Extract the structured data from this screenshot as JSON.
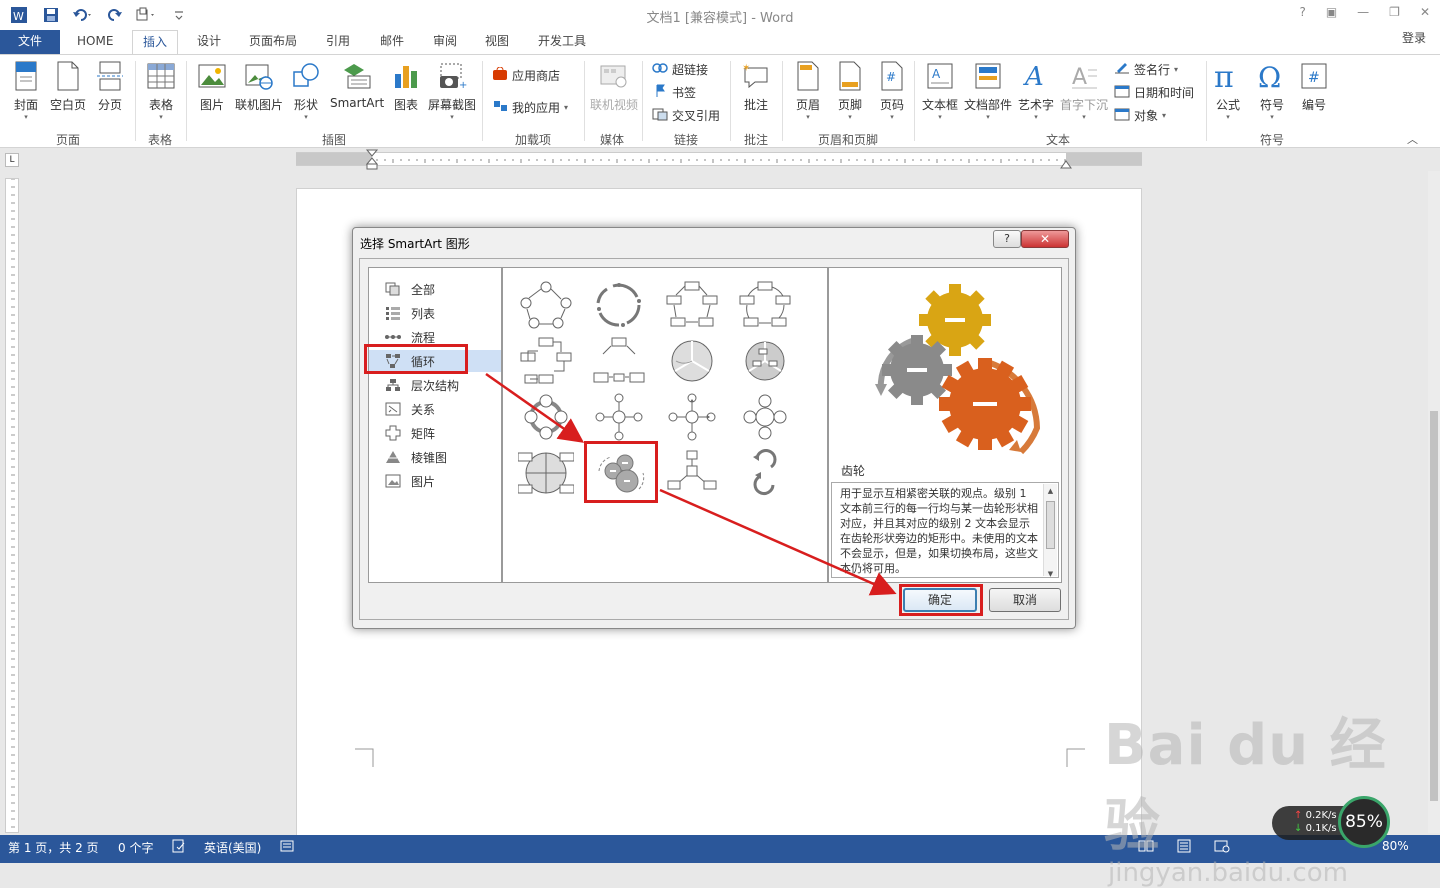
{
  "title_bar": {
    "title": "文档1 [兼容模式] - Word",
    "help": "?",
    "minimize": "—",
    "restore": "❐",
    "close": "✕"
  },
  "tabs": [
    {
      "label": "文件",
      "name": "tab-file"
    },
    {
      "label": "HOME",
      "name": "tab-home"
    },
    {
      "label": "插入",
      "name": "tab-insert"
    },
    {
      "label": "设计",
      "name": "tab-design"
    },
    {
      "label": "页面布局",
      "name": "tab-layout"
    },
    {
      "label": "引用",
      "name": "tab-references"
    },
    {
      "label": "邮件",
      "name": "tab-mailings"
    },
    {
      "label": "审阅",
      "name": "tab-review"
    },
    {
      "label": "视图",
      "name": "tab-view"
    },
    {
      "label": "开发工具",
      "name": "tab-developer"
    }
  ],
  "login": "登录",
  "ribbon": {
    "cover": "封面",
    "blank_page": "空白页",
    "page_break": "分页",
    "table": "表格",
    "picture": "图片",
    "online_picture": "联机图片",
    "shapes": "形状",
    "smartart": "SmartArt",
    "chart": "图表",
    "screenshot": "屏幕截图",
    "app_store": "应用商店",
    "my_apps": "我的应用",
    "online_video": "联机视频",
    "hyperlink": "超链接",
    "bookmark": "书签",
    "cross_ref": "交叉引用",
    "comment": "批注",
    "header": "页眉",
    "footer": "页脚",
    "page_number": "页码",
    "textbox": "文本框",
    "quick_parts": "文档部件",
    "wordart": "艺术字",
    "dropcap": "首字下沉",
    "signature": "签名行",
    "datetime": "日期和时间",
    "object": "对象",
    "equation": "公式",
    "symbol": "符号",
    "number": "编号",
    "groups": {
      "pages": "页面",
      "tables": "表格",
      "illustrations": "插图",
      "addins": "加载项",
      "media": "媒体",
      "links": "链接",
      "comments": "批注",
      "header_footer": "页眉和页脚",
      "text": "文本",
      "symbols": "符号"
    }
  },
  "dialog": {
    "title": "选择 SmartArt 图形",
    "help": "?",
    "close": "✕",
    "categories": [
      "全部",
      "列表",
      "流程",
      "循环",
      "层次结构",
      "关系",
      "矩阵",
      "棱锥图",
      "图片"
    ],
    "selected_category": "循环",
    "preview_name": "齿轮",
    "preview_desc": "用于显示互相紧密关联的观点。级别 1 文本前三行的每一行均与某一齿轮形状相对应，并且其对应的级别 2 文本会显示在齿轮形状旁边的矩形中。未使用的文本不会显示，但是，如果切换布局，这些文本仍将可用。",
    "ok": "确定",
    "cancel": "取消"
  },
  "status": {
    "page": "第 1 页，共 2 页",
    "words": "0 个字",
    "language": "英语(美国)",
    "zoom": "80%"
  },
  "network": {
    "up": "0.2K/s",
    "down": "0.1K/s",
    "percent": "85%"
  },
  "watermark": {
    "main": "Bai du 经验",
    "sub": "jingyan.baidu.com"
  }
}
